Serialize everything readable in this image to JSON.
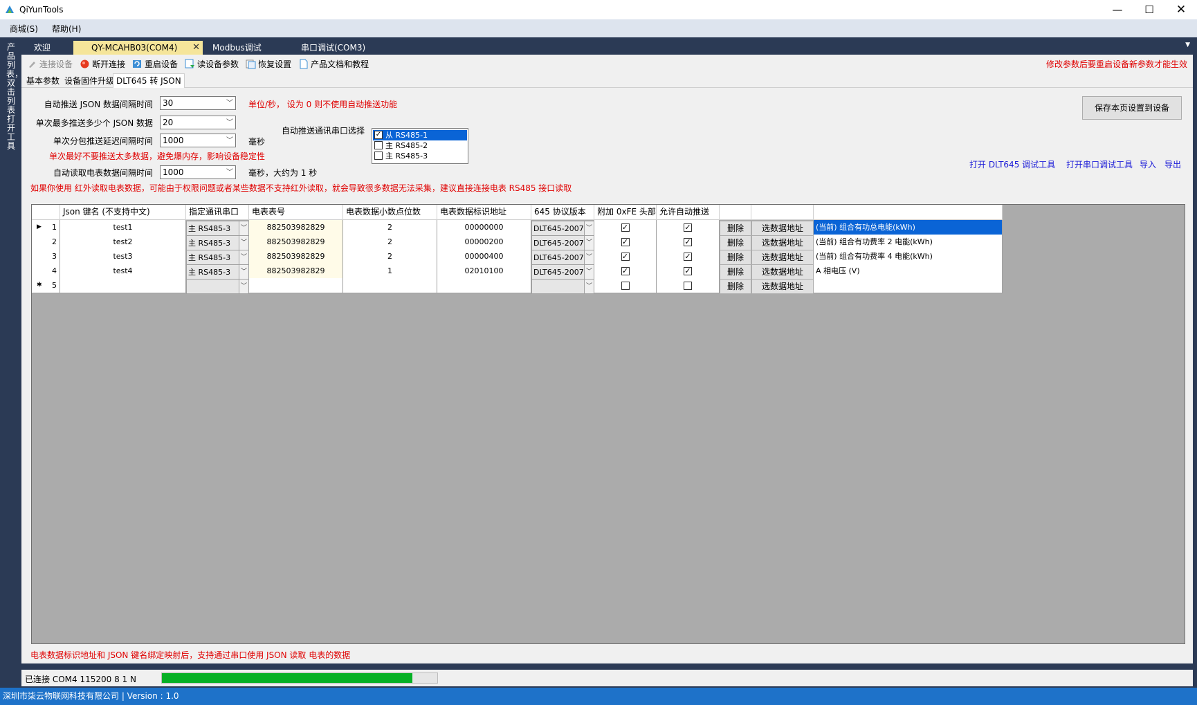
{
  "window": {
    "title": "QiYunTools"
  },
  "menu": [
    "商城(S)",
    "帮助(H)"
  ],
  "sidebar_text": "产品列表，双击列表打开工具",
  "doc_tabs": [
    {
      "label": "欢迎"
    },
    {
      "label": "QY-MCAHB03(COM4)",
      "active": true
    },
    {
      "label": "Modbus调试"
    },
    {
      "label": "串口调试(COM3)"
    }
  ],
  "toolbar": {
    "connect": "连接设备",
    "disconnect": "断开连接",
    "restart": "重启设备",
    "read_params": "读设备参数",
    "restore": "恢复设置",
    "docs": "产品文档和教程",
    "warning": "修改参数后要重启设备新参数才能生效"
  },
  "inner_tabs": [
    "基本参数",
    "设备固件升级",
    "DLT645 转 JSON"
  ],
  "form": {
    "push_interval_label": "自动推送 JSON 数据间隔时间",
    "push_interval_value": "30",
    "push_interval_note": "单位/秒， 设为 0 则不使用自动推送功能",
    "max_push_label": "单次最多推送多少个 JSON 数据",
    "max_push_value": "20",
    "delay_label": "单次分包推送延迟间隔时间",
    "delay_value": "1000",
    "delay_unit": "毫秒",
    "max_note": "单次最好不要推送太多数据，避免爆内存，影响设备稳定性",
    "read_interval_label": "自动读取电表数据间隔时间",
    "read_interval_value": "1000",
    "read_interval_unit": "毫秒，大约为 1 秒",
    "port_select_label": "自动推送通讯串口选择",
    "ports": [
      {
        "label": "从 RS485-1",
        "checked": true,
        "selected": true
      },
      {
        "label": "主 RS485-2",
        "checked": false
      },
      {
        "label": "主 RS485-3",
        "checked": false
      }
    ],
    "infrared_note": "如果你使用 红外读取电表数据，可能由于权限问题或者某些数据不支持红外读取，就会导致很多数据无法采集，建议直接连接电表 RS485 接口读取"
  },
  "save_button": "保存本页设置到设备",
  "links": [
    "打开 DLT645 调试工具",
    "打开串口调试工具",
    "导入",
    "导出"
  ],
  "table": {
    "headers": [
      "Json 键名 (不支持中文)",
      "指定通讯串口",
      "电表表号",
      "电表数据小数点位数",
      "电表数据标识地址",
      "645 协议版本",
      "附加 0xFE 头部",
      "允许自动推送"
    ],
    "delete_label": "删除",
    "select_label": "选数据地址",
    "rows": [
      {
        "num": "1",
        "key": "test1",
        "port": "主 RS485-3",
        "meter": "882503982829",
        "decimals": "2",
        "addr": "00000000",
        "proto": "DLT645-2007",
        "fe": true,
        "auto": true,
        "desc": "(当前) 组合有功总电能(kWh)",
        "current": true
      },
      {
        "num": "2",
        "key": "test2",
        "port": "主 RS485-3",
        "meter": "882503982829",
        "decimals": "2",
        "addr": "00000200",
        "proto": "DLT645-2007",
        "fe": true,
        "auto": true,
        "desc": "(当前) 组合有功费率 2 电能(kWh)"
      },
      {
        "num": "3",
        "key": "test3",
        "port": "主 RS485-3",
        "meter": "882503982829",
        "decimals": "2",
        "addr": "00000400",
        "proto": "DLT645-2007",
        "fe": true,
        "auto": true,
        "desc": "(当前) 组合有功费率 4 电能(kWh)"
      },
      {
        "num": "4",
        "key": "test4",
        "port": "主 RS485-3",
        "meter": "882503982829",
        "decimals": "1",
        "addr": "02010100",
        "proto": "DLT645-2007",
        "fe": true,
        "auto": true,
        "desc": "A 相电压 (V)"
      },
      {
        "num": "5",
        "key": "",
        "port": "",
        "meter": "",
        "decimals": "",
        "addr": "",
        "proto": "",
        "fe": false,
        "auto": false,
        "desc": "",
        "new": true
      }
    ]
  },
  "bottom_note": "电表数据标识地址和 JSON 键名绑定映射后，支持通过串口使用 JSON 读取 电表的数据",
  "status": {
    "text": "已连接 COM4 115200 8 1 N",
    "progress": 0.91
  },
  "footer": "深圳市柒云物联网科技有限公司  |  Version : 1.0",
  "colors": {
    "accent": "#1e72c9",
    "sidebar": "#2b3a55",
    "active_tab": "#f5e59a",
    "warning": "#e00000",
    "link": "#1a1ad8",
    "progress": "#06b025"
  }
}
